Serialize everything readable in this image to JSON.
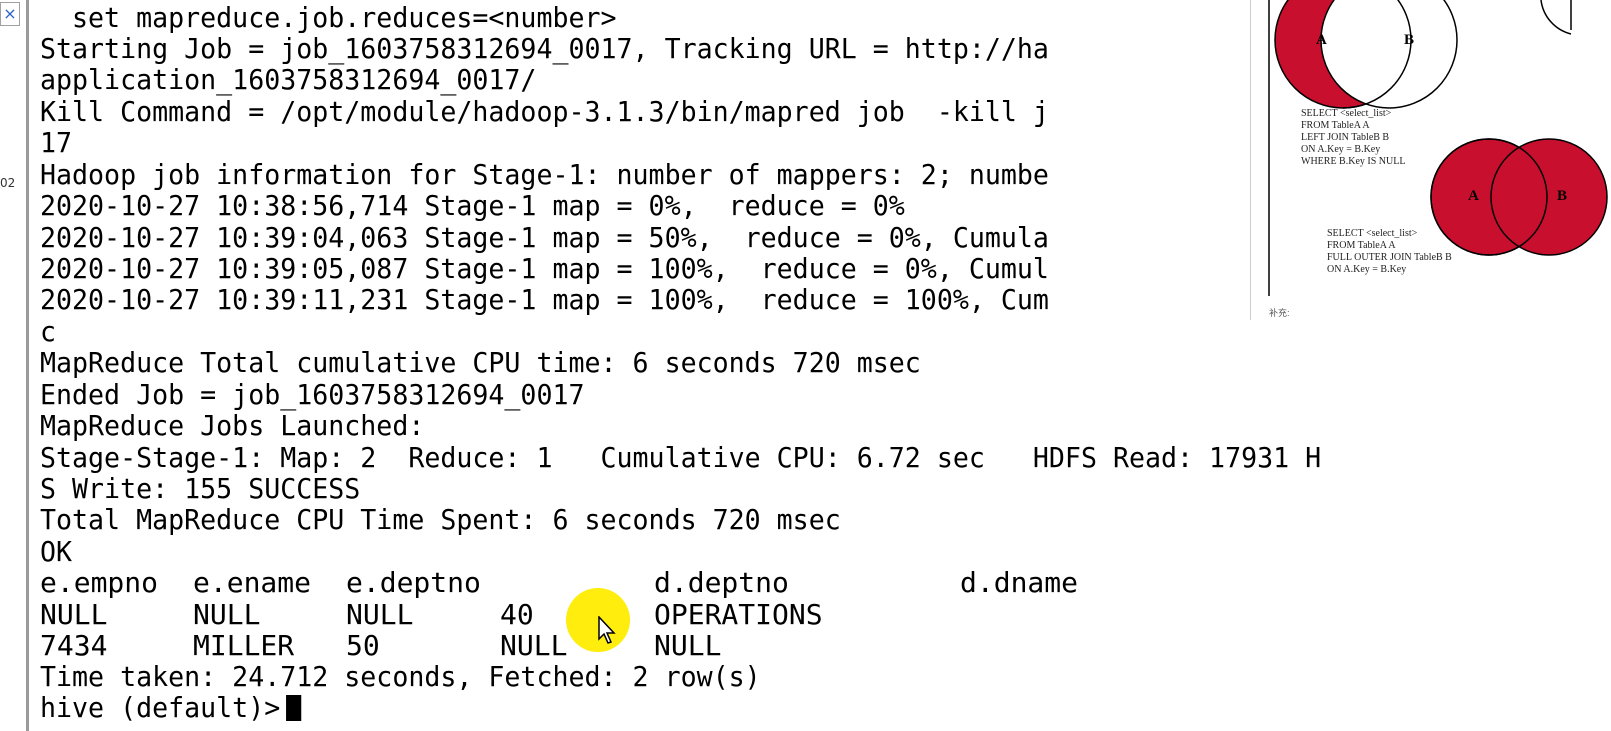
{
  "left_panel": {
    "close_glyph": "×",
    "number": "02"
  },
  "terminal": {
    "lines": [
      "  set mapreduce.job.reduces=<number>",
      "Starting Job = job_1603758312694_0017, Tracking URL = http://ha",
      "application_1603758312694_0017/",
      "Kill Command = /opt/module/hadoop-3.1.3/bin/mapred job  -kill j",
      "17",
      "Hadoop job information for Stage-1: number of mappers: 2; numbe",
      "2020-10-27 10:38:56,714 Stage-1 map = 0%,  reduce = 0%",
      "2020-10-27 10:39:04,063 Stage-1 map = 50%,  reduce = 0%, Cumula",
      "2020-10-27 10:39:05,087 Stage-1 map = 100%,  reduce = 0%, Cumul",
      "2020-10-27 10:39:11,231 Stage-1 map = 100%,  reduce = 100%, Cum",
      "c",
      "MapReduce Total cumulative CPU time: 6 seconds 720 msec",
      "Ended Job = job_1603758312694_0017",
      "MapReduce Jobs Launched:",
      "Stage-Stage-1: Map: 2  Reduce: 1   Cumulative CPU: 6.72 sec   HDFS Read: 17931 H",
      "S Write: 155 SUCCESS",
      "Total MapReduce CPU Time Spent: 6 seconds 720 msec",
      "OK"
    ],
    "result_headers": [
      "e.empno",
      "e.ename",
      "e.deptno",
      "",
      "d.deptno",
      "d.dname"
    ],
    "result_rows": [
      [
        "NULL",
        "NULL",
        "NULL",
        "40",
        "OPERATIONS",
        ""
      ],
      [
        "7434",
        "MILLER",
        "50",
        "NULL",
        "NULL",
        ""
      ]
    ],
    "time_taken": "Time taken: 24.712 seconds, Fetched: 2 row(s)",
    "prompt": "hive (default)>"
  },
  "overlay": {
    "left_join": {
      "circle_a": "A",
      "circle_b": "B",
      "sql": "SELECT <select_list>\nFROM TableA A\nLEFT JOIN TableB B\nON A.Key = B.Key\nWHERE B.Key IS NULL"
    },
    "full_outer_join": {
      "circle_a": "A",
      "circle_b": "B",
      "sql": "SELECT <select_list>\nFROM TableA A\nFULL OUTER JOIN TableB B\nON A.Key = B.Key"
    },
    "caption": "补充:",
    "fill_color": "#c8102e"
  }
}
